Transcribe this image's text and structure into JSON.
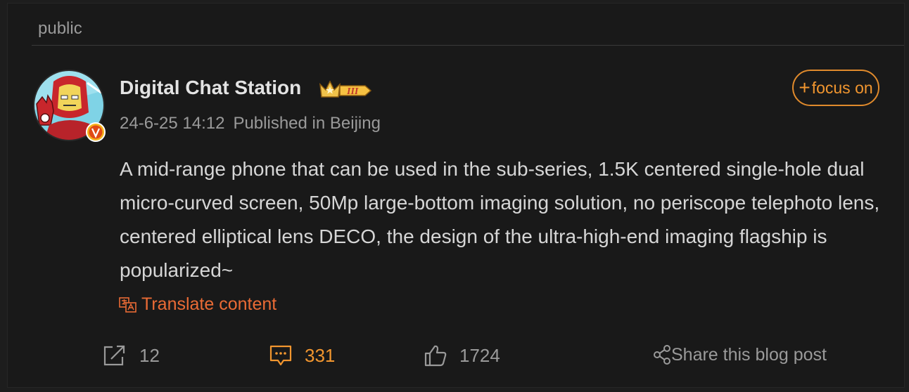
{
  "section_tag": "public",
  "post": {
    "author": "Digital Chat Station",
    "vip_level": "III",
    "date": "24-6-25 14:12",
    "location": "Published in Beijing",
    "follow_label": "focus on",
    "text": "A mid-range phone that can be used in the sub-series, 1.5K centered single-hole dual micro-curved screen, 50Mp large-bottom imaging solution, no periscope telephoto lens, centered elliptical lens DECO, the design of the ultra-high-end imaging flagship is popularized~",
    "translate_label": "Translate content"
  },
  "actions": {
    "shares": "12",
    "comments": "331",
    "likes": "1724",
    "share_post_label": "Share this blog post"
  },
  "colors": {
    "accent_orange": "#f2962f",
    "translate_orange": "#ea6b35",
    "background": "#191919",
    "muted_text": "#9a9a9a"
  }
}
